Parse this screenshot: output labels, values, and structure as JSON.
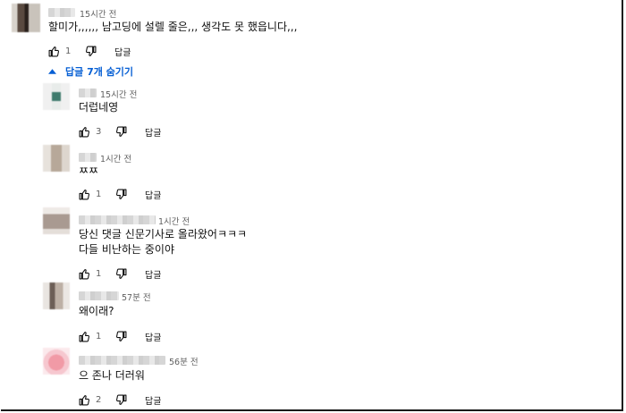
{
  "top_comment": {
    "time": "15시간 전",
    "text": "할미가,,,,,, 남고딩에 설렐 줄은,,, 생각도 못 했읍니다,,,",
    "likes": "1",
    "reply_label": "답글"
  },
  "replies_toggle": {
    "label": "답글 7개 숨기기"
  },
  "replies": [
    {
      "time": "15시간 전",
      "lines": [
        "더럽네영"
      ],
      "likes": "3",
      "reply_label": "답글"
    },
    {
      "time": "1시간 전",
      "lines": [
        "ㅉㅉ"
      ],
      "likes": "1",
      "reply_label": "답글"
    },
    {
      "time": "1시간 전",
      "lines": [
        "당신 댓글 신문기사로 올라왔어ㅋㅋㅋ",
        "다들 비난하는 중이야"
      ],
      "likes": "1",
      "reply_label": "답글"
    },
    {
      "time": "57분 전",
      "lines": [
        "왜이래?"
      ],
      "likes": "1",
      "reply_label": "답글"
    },
    {
      "time": "56분 전",
      "lines": [
        "으 존나 더러워"
      ],
      "likes": "2",
      "reply_label": "답글"
    }
  ],
  "colors": {
    "link": "#065fd4",
    "meta": "#606060",
    "text": "#0f0f0f"
  },
  "icons": {
    "like": "thumbs-up-icon",
    "dislike": "thumbs-down-icon",
    "toggle": "caret-up-icon"
  }
}
